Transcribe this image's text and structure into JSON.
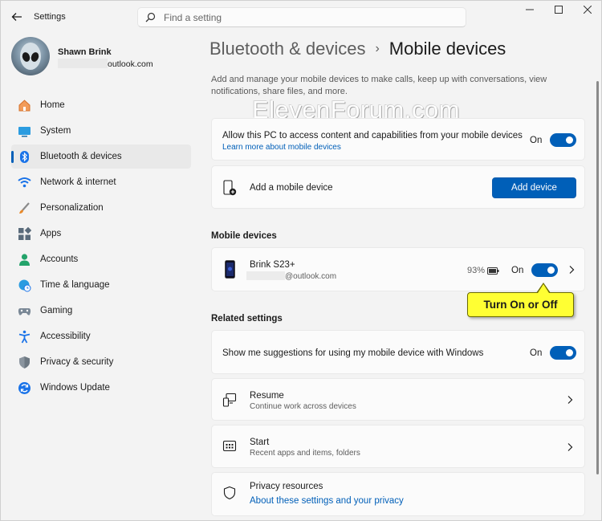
{
  "window": {
    "title": "Settings"
  },
  "search": {
    "placeholder": "Find a setting"
  },
  "profile": {
    "name": "Shawn Brink",
    "email_suffix": "outlook.com"
  },
  "sidebar": {
    "items": [
      {
        "label": "Home",
        "icon": "home-icon"
      },
      {
        "label": "System",
        "icon": "system-icon"
      },
      {
        "label": "Bluetooth & devices",
        "icon": "bluetooth-icon",
        "active": true
      },
      {
        "label": "Network & internet",
        "icon": "wifi-icon"
      },
      {
        "label": "Personalization",
        "icon": "brush-icon"
      },
      {
        "label": "Apps",
        "icon": "apps-icon"
      },
      {
        "label": "Accounts",
        "icon": "person-icon"
      },
      {
        "label": "Time & language",
        "icon": "globe-clock-icon"
      },
      {
        "label": "Gaming",
        "icon": "gamepad-icon"
      },
      {
        "label": "Accessibility",
        "icon": "accessibility-icon"
      },
      {
        "label": "Privacy & security",
        "icon": "shield-icon"
      },
      {
        "label": "Windows Update",
        "icon": "update-icon"
      }
    ]
  },
  "header": {
    "parent": "Bluetooth & devices",
    "separator": "›",
    "current": "Mobile devices"
  },
  "description": "Add and manage your mobile devices to make calls, keep up with conversations, view notifications, share files, and more.",
  "watermark": "ElevenForum.com",
  "allow_card": {
    "title": "Allow this PC to access content and capabilities from your mobile devices",
    "link": "Learn more about mobile devices",
    "toggle_label": "On",
    "toggle_on": true
  },
  "add_card": {
    "title": "Add a mobile device",
    "button": "Add device"
  },
  "mobile_devices": {
    "section_title": "Mobile devices",
    "device": {
      "name": "Brink S23+",
      "email_suffix": "@outlook.com",
      "battery": "93%",
      "toggle_label": "On",
      "toggle_on": true
    }
  },
  "callout": "Turn On or Off",
  "related": {
    "section_title": "Related settings",
    "suggestions": {
      "title": "Show me suggestions for using my mobile device with Windows",
      "toggle_label": "On",
      "toggle_on": true
    },
    "resume": {
      "title": "Resume",
      "subtitle": "Continue work across devices"
    },
    "start": {
      "title": "Start",
      "subtitle": "Recent apps and items, folders"
    },
    "privacy": {
      "title": "Privacy resources",
      "link": "About these settings and your privacy"
    }
  },
  "colors": {
    "accent": "#005fb8",
    "callout": "#ffff33"
  }
}
